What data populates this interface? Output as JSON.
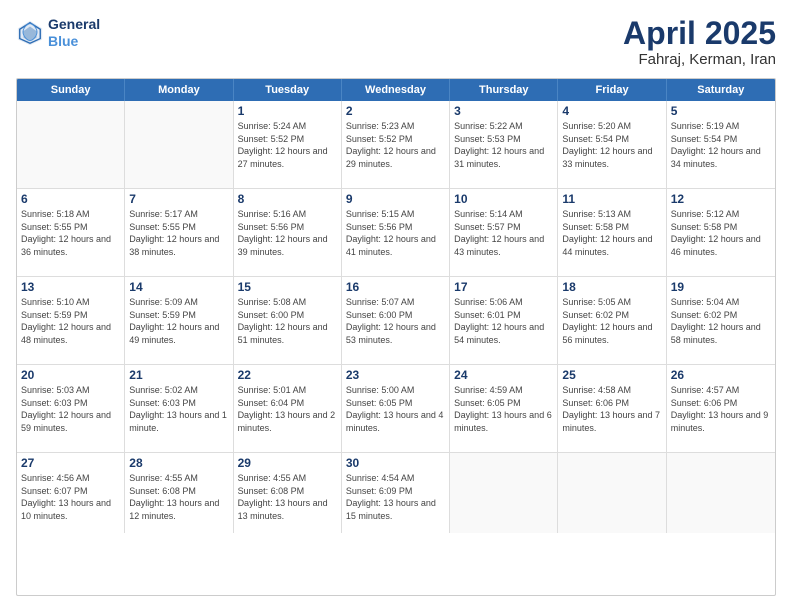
{
  "header": {
    "logo_line1": "General",
    "logo_line2": "Blue",
    "title": "April 2025",
    "subtitle": "Fahraj, Kerman, Iran"
  },
  "weekdays": [
    "Sunday",
    "Monday",
    "Tuesday",
    "Wednesday",
    "Thursday",
    "Friday",
    "Saturday"
  ],
  "rows": [
    [
      {
        "day": "",
        "sunrise": "",
        "sunset": "",
        "daylight": ""
      },
      {
        "day": "",
        "sunrise": "",
        "sunset": "",
        "daylight": ""
      },
      {
        "day": "1",
        "sunrise": "Sunrise: 5:24 AM",
        "sunset": "Sunset: 5:52 PM",
        "daylight": "Daylight: 12 hours and 27 minutes."
      },
      {
        "day": "2",
        "sunrise": "Sunrise: 5:23 AM",
        "sunset": "Sunset: 5:52 PM",
        "daylight": "Daylight: 12 hours and 29 minutes."
      },
      {
        "day": "3",
        "sunrise": "Sunrise: 5:22 AM",
        "sunset": "Sunset: 5:53 PM",
        "daylight": "Daylight: 12 hours and 31 minutes."
      },
      {
        "day": "4",
        "sunrise": "Sunrise: 5:20 AM",
        "sunset": "Sunset: 5:54 PM",
        "daylight": "Daylight: 12 hours and 33 minutes."
      },
      {
        "day": "5",
        "sunrise": "Sunrise: 5:19 AM",
        "sunset": "Sunset: 5:54 PM",
        "daylight": "Daylight: 12 hours and 34 minutes."
      }
    ],
    [
      {
        "day": "6",
        "sunrise": "Sunrise: 5:18 AM",
        "sunset": "Sunset: 5:55 PM",
        "daylight": "Daylight: 12 hours and 36 minutes."
      },
      {
        "day": "7",
        "sunrise": "Sunrise: 5:17 AM",
        "sunset": "Sunset: 5:55 PM",
        "daylight": "Daylight: 12 hours and 38 minutes."
      },
      {
        "day": "8",
        "sunrise": "Sunrise: 5:16 AM",
        "sunset": "Sunset: 5:56 PM",
        "daylight": "Daylight: 12 hours and 39 minutes."
      },
      {
        "day": "9",
        "sunrise": "Sunrise: 5:15 AM",
        "sunset": "Sunset: 5:56 PM",
        "daylight": "Daylight: 12 hours and 41 minutes."
      },
      {
        "day": "10",
        "sunrise": "Sunrise: 5:14 AM",
        "sunset": "Sunset: 5:57 PM",
        "daylight": "Daylight: 12 hours and 43 minutes."
      },
      {
        "day": "11",
        "sunrise": "Sunrise: 5:13 AM",
        "sunset": "Sunset: 5:58 PM",
        "daylight": "Daylight: 12 hours and 44 minutes."
      },
      {
        "day": "12",
        "sunrise": "Sunrise: 5:12 AM",
        "sunset": "Sunset: 5:58 PM",
        "daylight": "Daylight: 12 hours and 46 minutes."
      }
    ],
    [
      {
        "day": "13",
        "sunrise": "Sunrise: 5:10 AM",
        "sunset": "Sunset: 5:59 PM",
        "daylight": "Daylight: 12 hours and 48 minutes."
      },
      {
        "day": "14",
        "sunrise": "Sunrise: 5:09 AM",
        "sunset": "Sunset: 5:59 PM",
        "daylight": "Daylight: 12 hours and 49 minutes."
      },
      {
        "day": "15",
        "sunrise": "Sunrise: 5:08 AM",
        "sunset": "Sunset: 6:00 PM",
        "daylight": "Daylight: 12 hours and 51 minutes."
      },
      {
        "day": "16",
        "sunrise": "Sunrise: 5:07 AM",
        "sunset": "Sunset: 6:00 PM",
        "daylight": "Daylight: 12 hours and 53 minutes."
      },
      {
        "day": "17",
        "sunrise": "Sunrise: 5:06 AM",
        "sunset": "Sunset: 6:01 PM",
        "daylight": "Daylight: 12 hours and 54 minutes."
      },
      {
        "day": "18",
        "sunrise": "Sunrise: 5:05 AM",
        "sunset": "Sunset: 6:02 PM",
        "daylight": "Daylight: 12 hours and 56 minutes."
      },
      {
        "day": "19",
        "sunrise": "Sunrise: 5:04 AM",
        "sunset": "Sunset: 6:02 PM",
        "daylight": "Daylight: 12 hours and 58 minutes."
      }
    ],
    [
      {
        "day": "20",
        "sunrise": "Sunrise: 5:03 AM",
        "sunset": "Sunset: 6:03 PM",
        "daylight": "Daylight: 12 hours and 59 minutes."
      },
      {
        "day": "21",
        "sunrise": "Sunrise: 5:02 AM",
        "sunset": "Sunset: 6:03 PM",
        "daylight": "Daylight: 13 hours and 1 minute."
      },
      {
        "day": "22",
        "sunrise": "Sunrise: 5:01 AM",
        "sunset": "Sunset: 6:04 PM",
        "daylight": "Daylight: 13 hours and 2 minutes."
      },
      {
        "day": "23",
        "sunrise": "Sunrise: 5:00 AM",
        "sunset": "Sunset: 6:05 PM",
        "daylight": "Daylight: 13 hours and 4 minutes."
      },
      {
        "day": "24",
        "sunrise": "Sunrise: 4:59 AM",
        "sunset": "Sunset: 6:05 PM",
        "daylight": "Daylight: 13 hours and 6 minutes."
      },
      {
        "day": "25",
        "sunrise": "Sunrise: 4:58 AM",
        "sunset": "Sunset: 6:06 PM",
        "daylight": "Daylight: 13 hours and 7 minutes."
      },
      {
        "day": "26",
        "sunrise": "Sunrise: 4:57 AM",
        "sunset": "Sunset: 6:06 PM",
        "daylight": "Daylight: 13 hours and 9 minutes."
      }
    ],
    [
      {
        "day": "27",
        "sunrise": "Sunrise: 4:56 AM",
        "sunset": "Sunset: 6:07 PM",
        "daylight": "Daylight: 13 hours and 10 minutes."
      },
      {
        "day": "28",
        "sunrise": "Sunrise: 4:55 AM",
        "sunset": "Sunset: 6:08 PM",
        "daylight": "Daylight: 13 hours and 12 minutes."
      },
      {
        "day": "29",
        "sunrise": "Sunrise: 4:55 AM",
        "sunset": "Sunset: 6:08 PM",
        "daylight": "Daylight: 13 hours and 13 minutes."
      },
      {
        "day": "30",
        "sunrise": "Sunrise: 4:54 AM",
        "sunset": "Sunset: 6:09 PM",
        "daylight": "Daylight: 13 hours and 15 minutes."
      },
      {
        "day": "",
        "sunrise": "",
        "sunset": "",
        "daylight": ""
      },
      {
        "day": "",
        "sunrise": "",
        "sunset": "",
        "daylight": ""
      },
      {
        "day": "",
        "sunrise": "",
        "sunset": "",
        "daylight": ""
      }
    ]
  ]
}
